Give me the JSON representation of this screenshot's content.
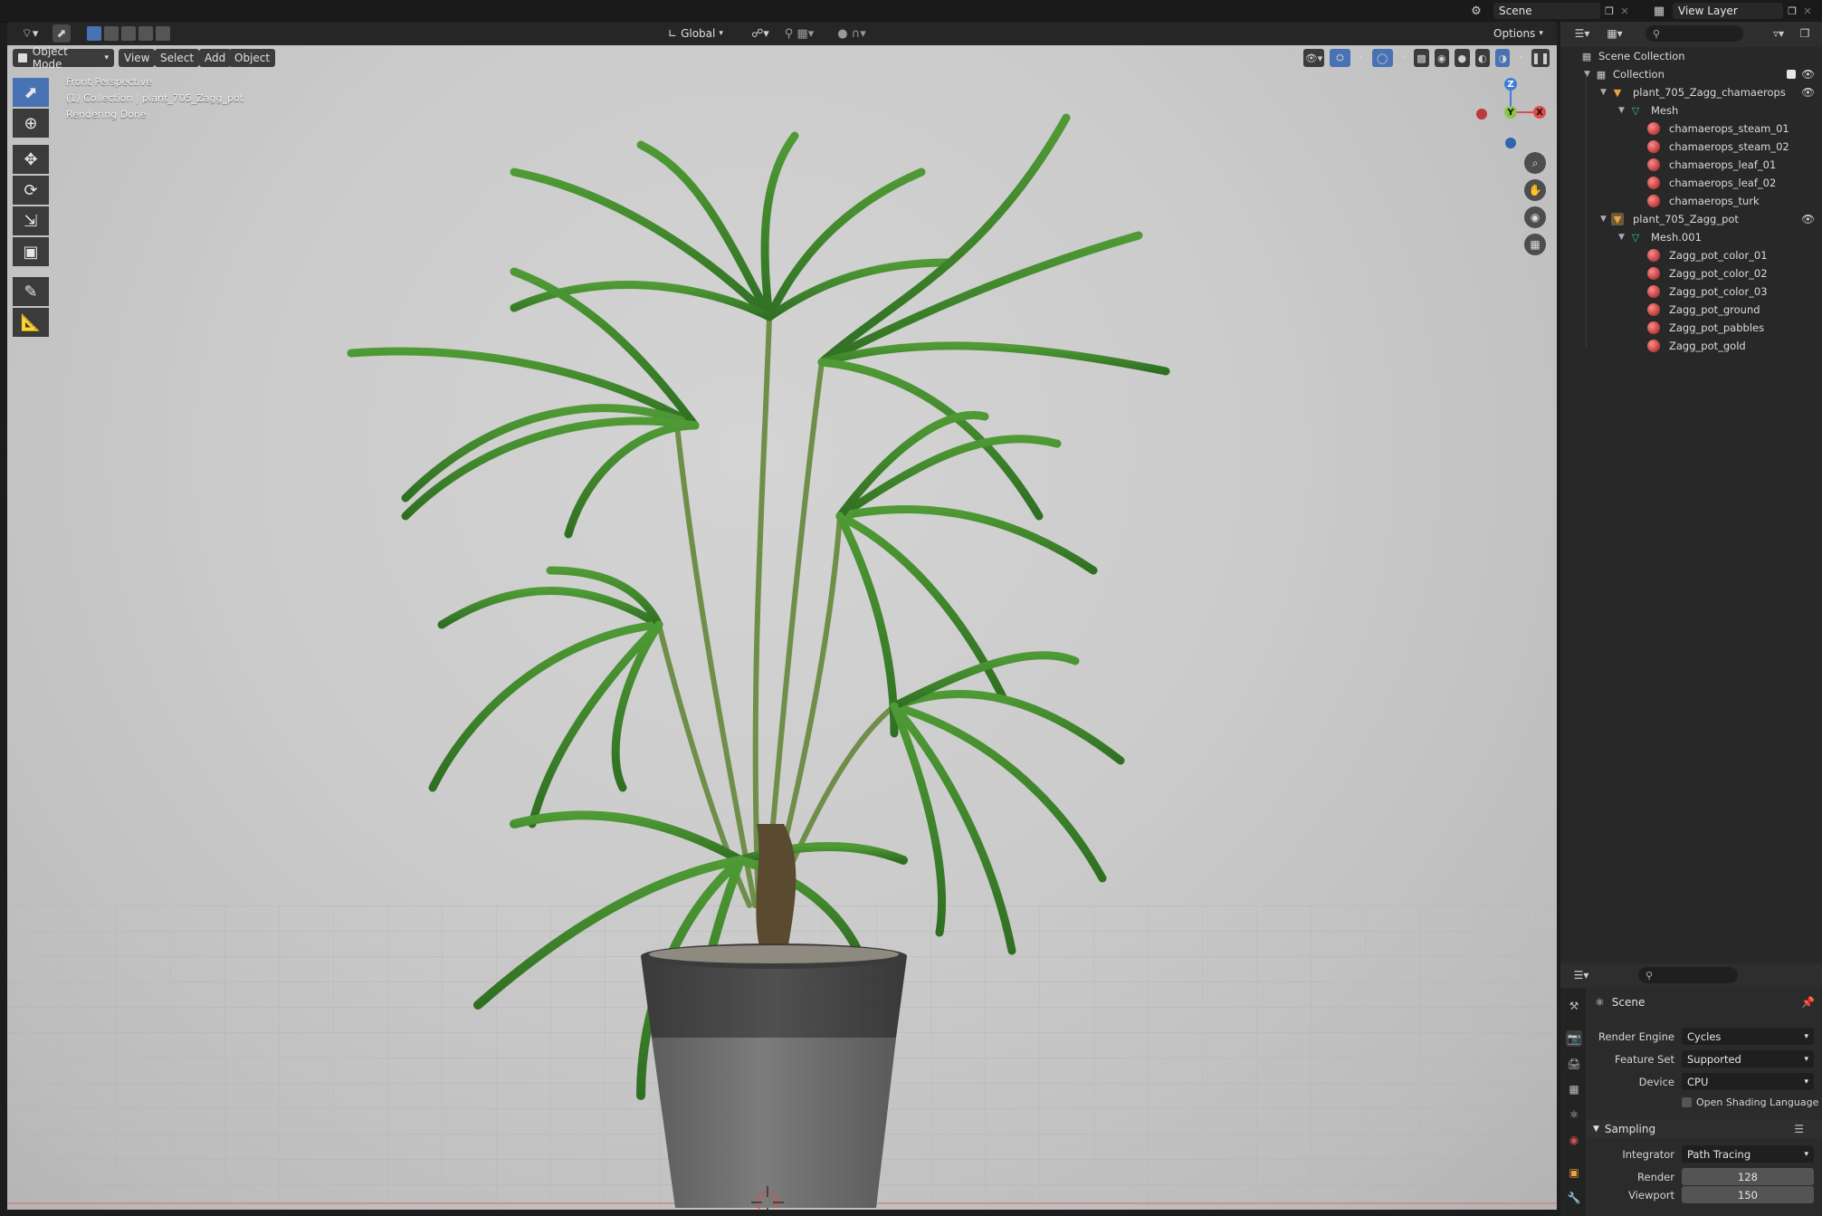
{
  "topbar": {
    "scene_label": "Scene",
    "view_layer_label": "View Layer"
  },
  "viewport_header": {
    "mode": "Object Mode",
    "menus": [
      "View",
      "Select",
      "Add",
      "Object"
    ],
    "transform_orientation": "Global",
    "options_label": "Options"
  },
  "viewport": {
    "perspective": "Front Perspective",
    "collection_info": "(1) Collection | plant_705_Zagg_pot",
    "status": "Rendering Done",
    "gizmo_axes": {
      "z": "Z",
      "y": "Y",
      "x": "X"
    }
  },
  "outliner": {
    "root": "Scene Collection",
    "collection": "Collection",
    "objects": [
      {
        "name": "plant_705_Zagg_chamaerops",
        "mesh": "Mesh",
        "materials": [
          "chamaerops_steam_01",
          "chamaerops_steam_02",
          "chamaerops_leaf_01",
          "chamaerops_leaf_02",
          "chamaerops_turk"
        ]
      },
      {
        "name": "plant_705_Zagg_pot",
        "mesh": "Mesh.001",
        "materials": [
          "Zagg_pot_color_01",
          "Zagg_pot_color_02",
          "Zagg_pot_color_03",
          "Zagg_pot_ground",
          "Zagg_pot_pabbles",
          "Zagg_pot_gold"
        ]
      }
    ]
  },
  "properties": {
    "context": "Scene",
    "render_engine": {
      "label": "Render Engine",
      "value": "Cycles"
    },
    "feature_set": {
      "label": "Feature Set",
      "value": "Supported"
    },
    "device": {
      "label": "Device",
      "value": "CPU"
    },
    "osl_label": "Open Shading Language",
    "sampling": {
      "title": "Sampling",
      "integrator": {
        "label": "Integrator",
        "value": "Path Tracing"
      },
      "render": {
        "label": "Render",
        "value": "128"
      },
      "viewport": {
        "label": "Viewport",
        "value": "150"
      }
    }
  },
  "colors": {
    "accent": "#4772b3",
    "leaf": "#3f8a2a",
    "pot_dark": "#4a4a4a",
    "pot_light": "#8a8a8a"
  }
}
